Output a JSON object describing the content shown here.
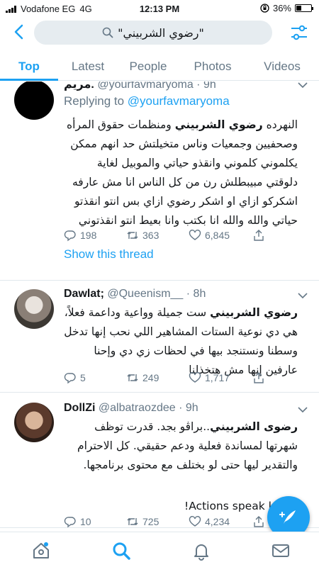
{
  "status_bar": {
    "carrier": "Vodafone EG",
    "network": "4G",
    "time": "12:13 PM",
    "battery": "36%",
    "battery_level": 0.36
  },
  "search": {
    "query": "\"رضوي الشربيني\""
  },
  "tabs": [
    {
      "label": "Top",
      "active": true
    },
    {
      "label": "Latest",
      "active": false
    },
    {
      "label": "People",
      "active": false
    },
    {
      "label": "Photos",
      "active": false
    },
    {
      "label": "Videos",
      "active": false
    }
  ],
  "tweets": [
    {
      "name": "مريم.",
      "handle": "@yourfavmaryoma",
      "time": "9h",
      "replying_to_label": "Replying to",
      "replying_to": "@yourfavmaryoma",
      "body_highlight": "رضوي الشربيني",
      "body_before": "النهرده ",
      "body_after": " ومنظمات حقوق المرأه وصحفيين وجمعيات وناس متخيلتش حد انهم ممكن يكلموني كلموني وانقذو حياتي والموبيل لغاية دلوقتي مبيبطلش رن من كل الناس انا مش عارفه اشكركو ازاي او اشكر رضوي ازاي بس انتو انقذتو حياتي والله والله انا بكتب وانا بعيط انتو انقذتوني",
      "replies": "198",
      "retweets": "363",
      "likes": "6,845",
      "show_thread": "Show this thread"
    },
    {
      "name": "Dawlat;",
      "handle": "@Queenism__",
      "time": "8h",
      "body_highlight": "رضوي الشربيني",
      "body_before": "",
      "body_after": " ست جميلة وواعية وداعمة فعلاً، هي دي نوعية الستات المشاهير اللي نحب إنها تدخل وسطنا ونستنجد بيها في لحظات زي دي وإحنا عارفين إنها مش هتخذلنا",
      "replies": "5",
      "retweets": "249",
      "likes": "1,717"
    },
    {
      "name": "DollZi",
      "handle": "@albatraozdee",
      "time": "9h",
      "body_highlight": "رضوى الشربيني",
      "body_before": "",
      "body_after": "..براڤو بجد. قدرت توظف شهرتها لمساندة فعلية ودعم حقيقي. كل الاحترام والتقدير ليها حتى لو بختلف مع محتوى برنامجها.",
      "body_tail": "!Actions speak l",
      "replies": "10",
      "retweets": "725",
      "likes": "4,234"
    }
  ],
  "colors": {
    "accent": "#1da1f2",
    "muted": "#657786",
    "text": "#14171a",
    "divider": "#e1e8ed"
  },
  "icons": [
    "back-arrow-icon",
    "search-icon",
    "filter-sliders-icon",
    "chevron-down-icon",
    "reply-icon",
    "retweet-icon",
    "like-icon",
    "share-icon",
    "compose-icon",
    "home-icon",
    "explore-icon",
    "notifications-icon",
    "messages-icon"
  ]
}
